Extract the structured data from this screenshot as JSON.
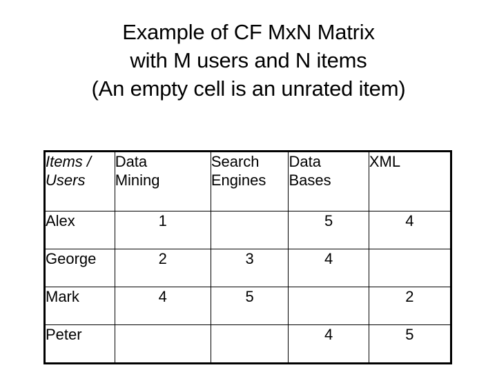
{
  "slide": {
    "title_lines": [
      "Example of CF MxN Matrix",
      "with M users and N items",
      "(An empty cell is an unrated item)"
    ],
    "background_color": "#ffffff",
    "text_color": "#000000"
  },
  "matrix": {
    "corner_label_line1": "Items /",
    "corner_label_line2": "Users",
    "column_headers": [
      {
        "line1": "Data",
        "line2": "Mining"
      },
      {
        "line1": "Search",
        "line2": "Engines"
      },
      {
        "line1": "Data",
        "line2": "Bases"
      },
      {
        "line1": "XML",
        "line2": ""
      }
    ],
    "rows": [
      {
        "user": "Alex",
        "ratings": [
          "1",
          "",
          "5",
          "4"
        ]
      },
      {
        "user": "George",
        "ratings": [
          "2",
          "3",
          "4",
          ""
        ]
      },
      {
        "user": "Mark",
        "ratings": [
          "4",
          "5",
          "",
          "2"
        ]
      },
      {
        "user": "Peter",
        "ratings": [
          "",
          "",
          "4",
          "5"
        ]
      }
    ]
  },
  "chart_data": {
    "type": "table",
    "title": "Example of CF MxN Matrix with M users and N items (An empty cell is an unrated item)",
    "row_label": "Users",
    "column_label": "Items",
    "categories": [
      "Data Mining",
      "Search Engines",
      "Data Bases",
      "XML"
    ],
    "series": [
      {
        "name": "Alex",
        "values": [
          1,
          null,
          5,
          4
        ]
      },
      {
        "name": "George",
        "values": [
          2,
          3,
          4,
          null
        ]
      },
      {
        "name": "Mark",
        "values": [
          4,
          5,
          null,
          2
        ]
      },
      {
        "name": "Peter",
        "values": [
          null,
          null,
          4,
          5
        ]
      }
    ],
    "value_range": [
      1,
      5
    ],
    "missing_value_meaning": "unrated item"
  }
}
